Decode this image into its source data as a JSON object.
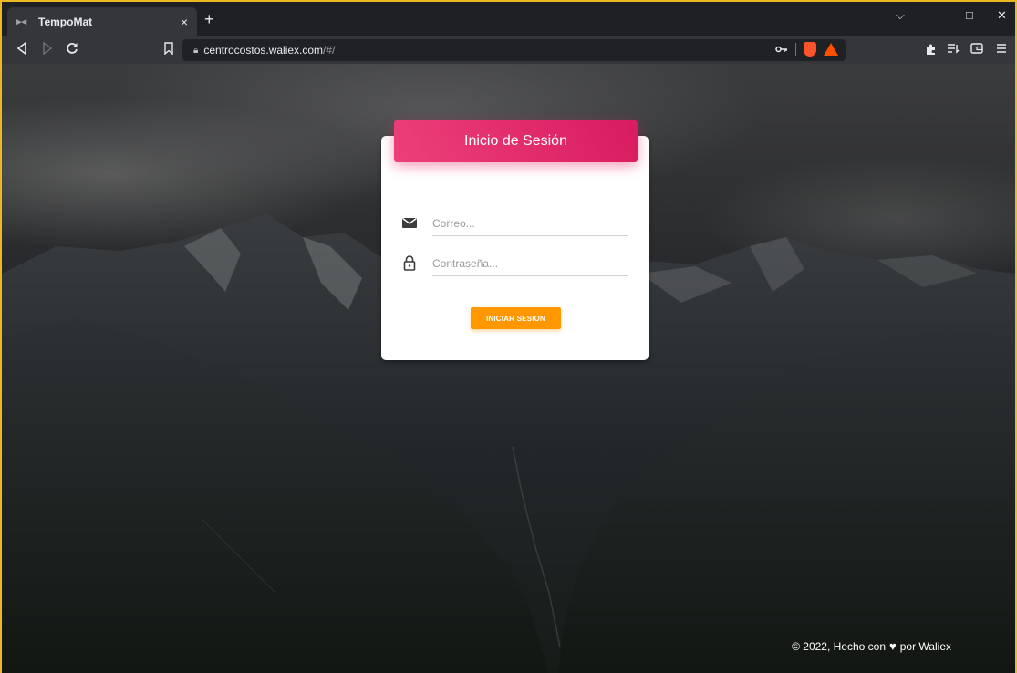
{
  "browser": {
    "tab_title": "TempoMat",
    "tab_close": "×",
    "new_tab": "+",
    "url_host": "centrocostos.waliex.com",
    "url_path": "/#/",
    "window_controls": {
      "minimize": "–",
      "maximize": "□",
      "close": "✕",
      "dropdown": "⌵"
    }
  },
  "login": {
    "title": "Inicio de Sesión",
    "email_placeholder": "Correo...",
    "password_placeholder": "Contraseña...",
    "button_label": "INICIAR SESION"
  },
  "footer": {
    "prefix": "© 2022, Hecho con",
    "suffix": "por Waliex"
  },
  "colors": {
    "header_gradient_start": "#ec407a",
    "header_gradient_end": "#d81b60",
    "button": "#ff9800",
    "window_border": "#e9b824"
  }
}
